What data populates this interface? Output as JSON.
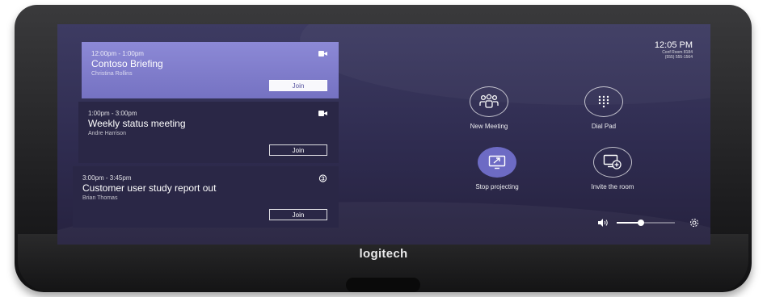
{
  "brand": "logitech",
  "clock": {
    "time": "12:05 PM",
    "room": "Conf Room 8184",
    "phone": "(555) 555-1564"
  },
  "meetings": [
    {
      "time": "12:00pm - 1:00pm",
      "title": "Contoso Briefing",
      "organizer": "Christina Rollins",
      "join_label": "Join",
      "icon": "teams-video-icon"
    },
    {
      "time": "1:00pm - 3:00pm",
      "title": "Weekly status meeting",
      "organizer": "Andre Harrison",
      "join_label": "Join",
      "icon": "teams-video-icon"
    },
    {
      "time": "3:00pm - 3:45pm",
      "title": "Customer user study report out",
      "organizer": "Brian Thomas",
      "join_label": "Join",
      "icon": "skype-icon"
    }
  ],
  "actions": {
    "new_meeting": {
      "label": "New Meeting",
      "icon": "people-icon"
    },
    "dial_pad": {
      "label": "Dial Pad",
      "icon": "dialpad-icon"
    },
    "stop_projecting": {
      "label": "Stop projecting",
      "icon": "projection-icon"
    },
    "invite_room": {
      "label": "Invite the room",
      "icon": "invite-screen-icon"
    }
  },
  "volume": {
    "level": 0.42
  },
  "colors": {
    "accent": "#6d6bc4",
    "active_card": "#8c89d6",
    "card": "#2a2746",
    "screen": "#302c52"
  }
}
